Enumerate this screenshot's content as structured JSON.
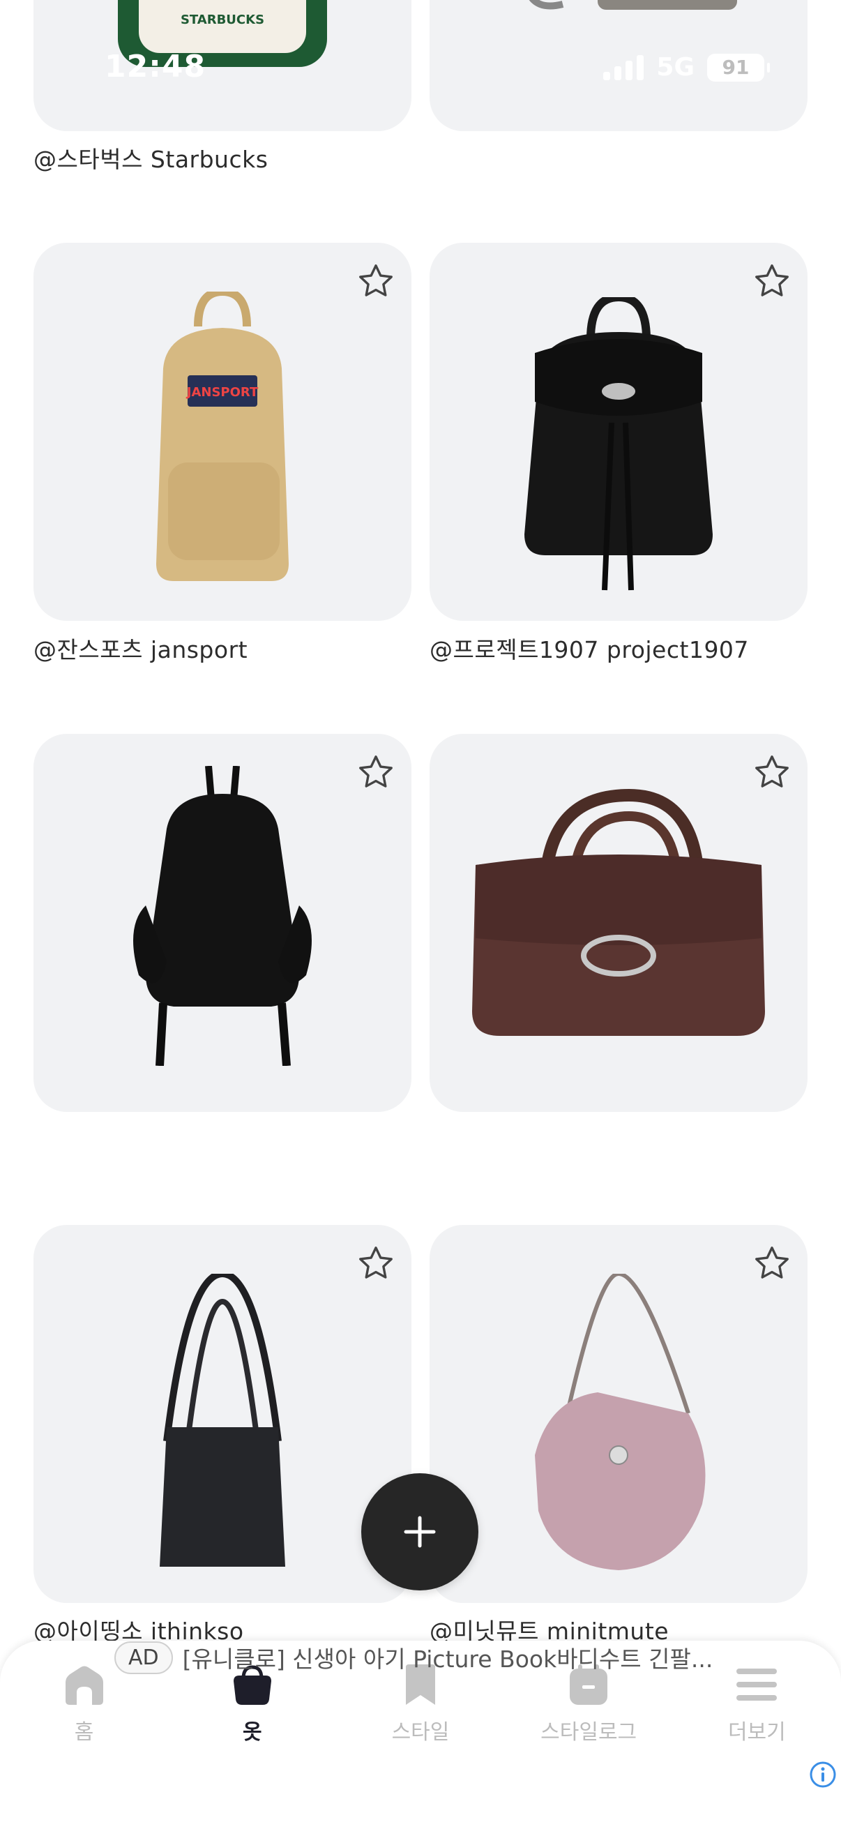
{
  "status_bar": {
    "time": "12:48",
    "network": "5G",
    "battery": "91"
  },
  "products": [
    {
      "caption": "@스타벅스 Starbucks",
      "image": "green-tote-bag",
      "favorited": false
    },
    {
      "caption": "",
      "image": "grey-bag",
      "favorited": false
    },
    {
      "caption": "@잔스포츠 jansport",
      "image": "beige-backpack",
      "favorited": false
    },
    {
      "caption": "@프로젝트1907 project1907",
      "image": "black-drawstring-backpack",
      "favorited": false
    },
    {
      "caption": "",
      "image": "black-nylon-backpack",
      "favorited": false
    },
    {
      "caption": "",
      "image": "brown-leather-handbag",
      "favorited": false
    },
    {
      "caption": "@아이띵소 ithinkso",
      "image": "black-tote-bag",
      "favorited": false
    },
    {
      "caption": "@미닛뮤트 minitmute",
      "image": "pink-corduroy-hobo-bag",
      "favorited": false
    }
  ],
  "fab": {
    "icon": "plus-icon"
  },
  "nav": {
    "items": [
      {
        "label": "홈",
        "icon": "home-icon",
        "active": false
      },
      {
        "label": "옷",
        "icon": "bag-icon",
        "active": true
      },
      {
        "label": "스타일",
        "icon": "bookmark-icon",
        "active": false
      },
      {
        "label": "스타일로그",
        "icon": "calendar-icon",
        "active": false
      },
      {
        "label": "더보기",
        "icon": "menu-icon",
        "active": false
      }
    ]
  },
  "ad": {
    "badge": "AD",
    "text": "[유니클로] 신생아 아기 Picture Book바디수트 긴팔..."
  },
  "colors": {
    "card": "#f1f2f4",
    "fab": "#262626",
    "active_nav": "#1e1e2a",
    "inactive_nav": "#c4c4c4"
  }
}
